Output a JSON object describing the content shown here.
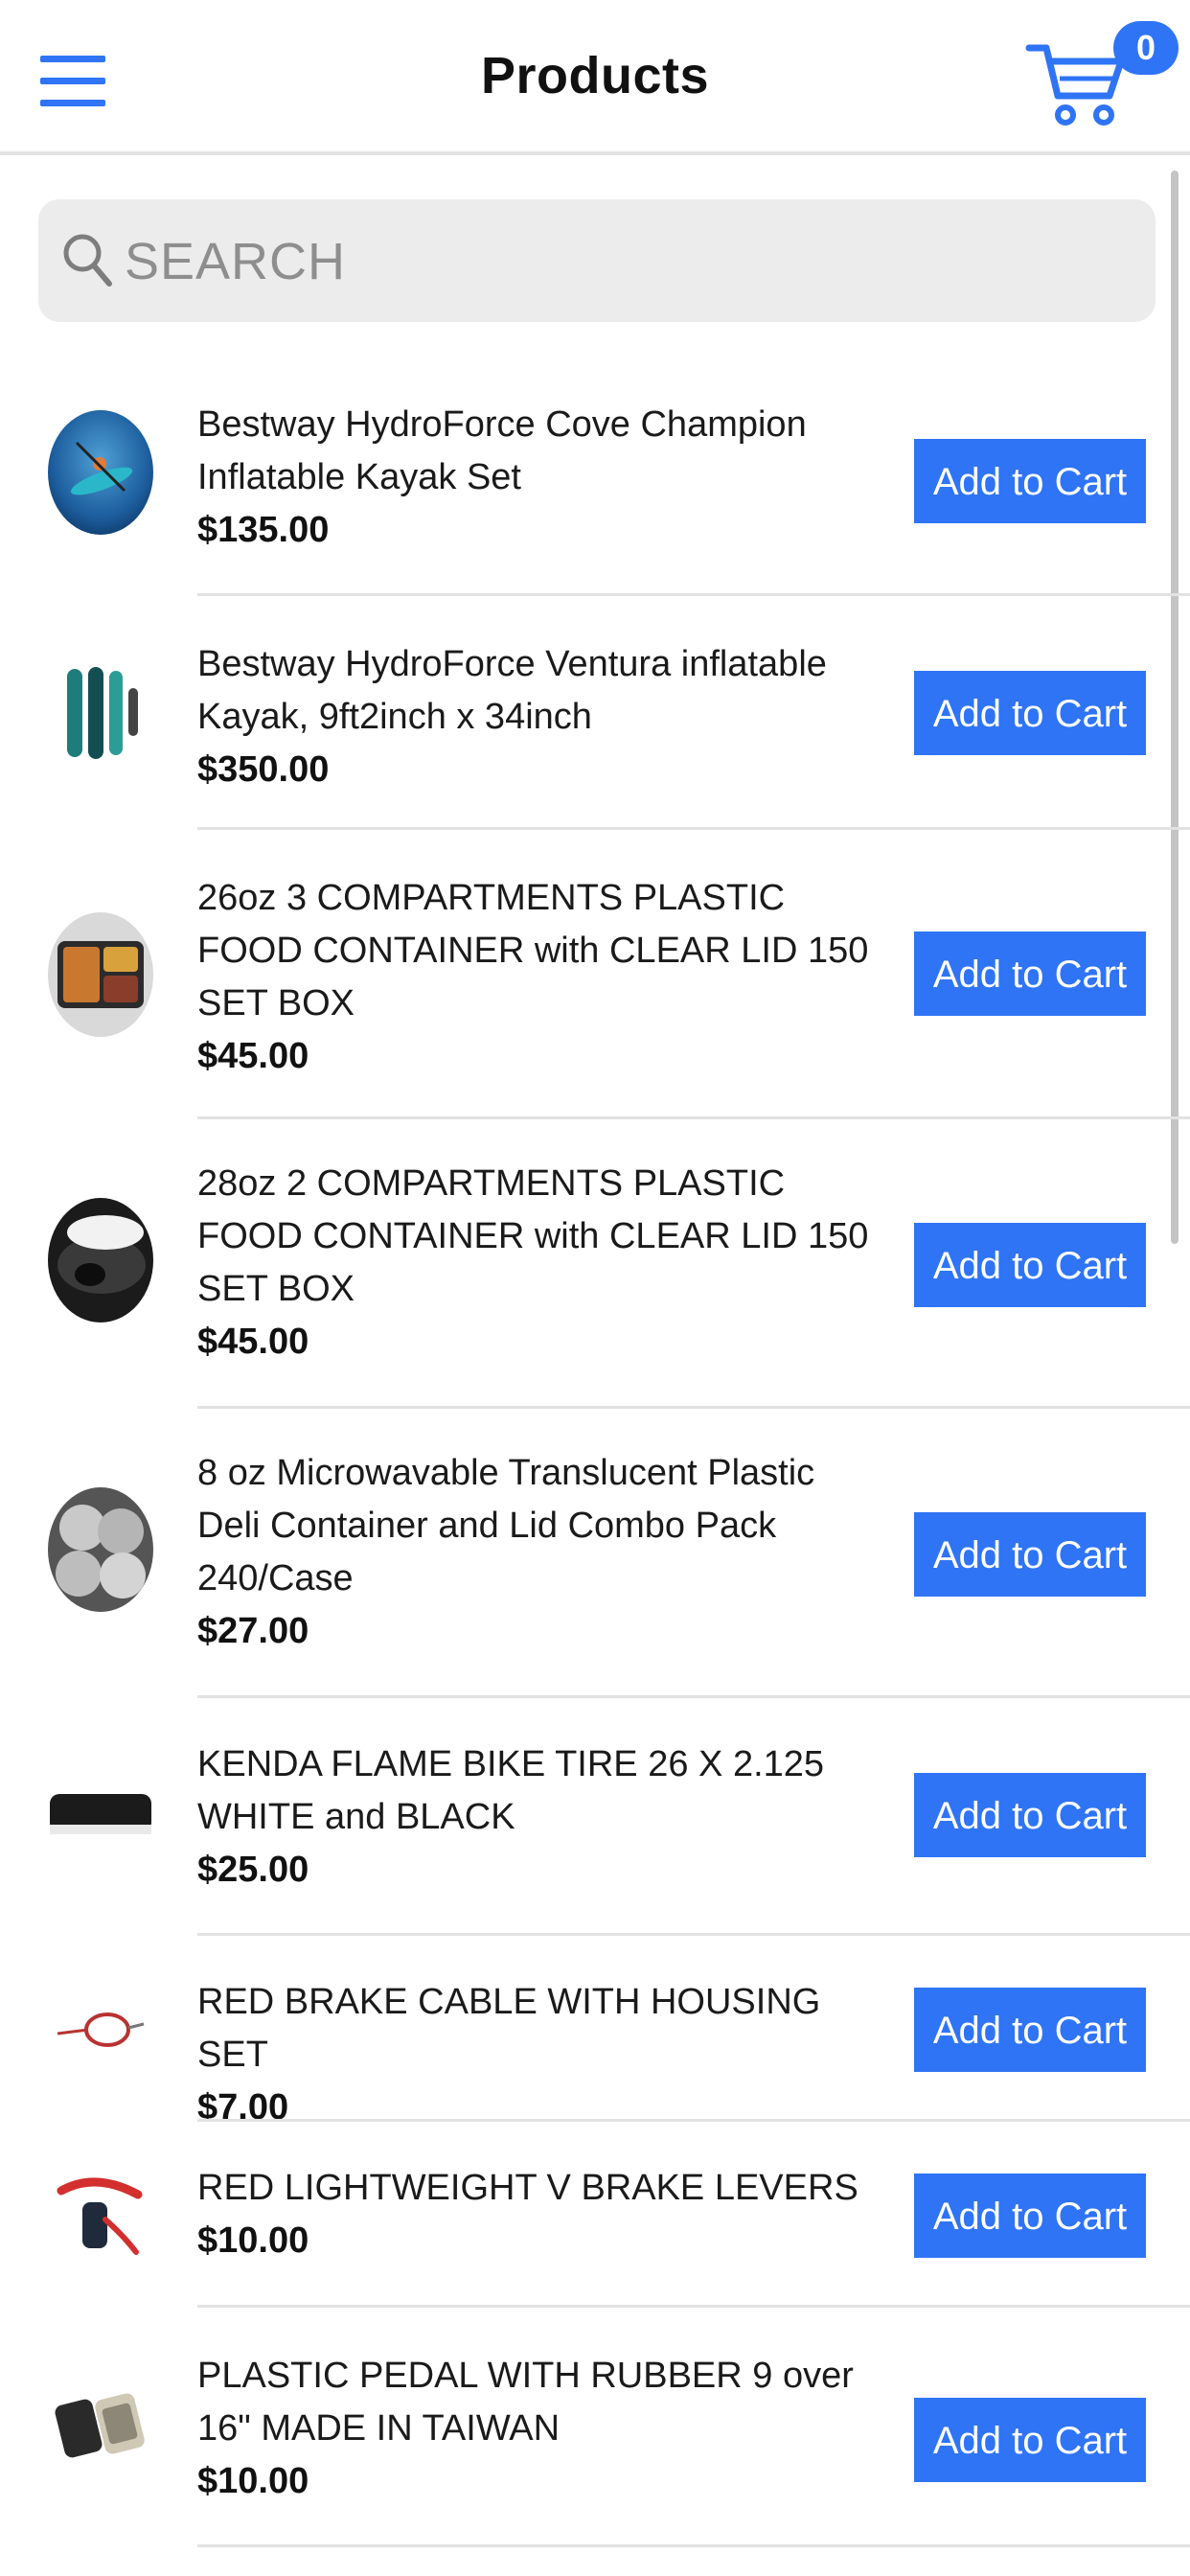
{
  "header": {
    "title": "Products",
    "cart_count": "0"
  },
  "search": {
    "placeholder": "SEARCH"
  },
  "products": [
    {
      "name": "Bestway HydroForce Cove Champion Inflatable Kayak Set",
      "price": "$135.00",
      "button": "Add to Cart"
    },
    {
      "name": "Bestway HydroForce Ventura inflatable Kayak, 9ft2inch x 34inch",
      "price": "$350.00",
      "button": "Add to Cart"
    },
    {
      "name": "26oz 3 COMPARTMENTS PLASTIC FOOD CONTAINER with CLEAR LID 150 SET BOX",
      "price": "$45.00",
      "button": "Add to Cart"
    },
    {
      "name": "28oz 2 COMPARTMENTS PLASTIC FOOD CONTAINER with CLEAR LID 150 SET BOX",
      "price": "$45.00",
      "button": "Add to Cart"
    },
    {
      "name": "8 oz Microwavable Translucent Plastic Deli Container and Lid Combo Pack 240/Case",
      "price": "$27.00",
      "button": "Add to Cart"
    },
    {
      "name": "KENDA FLAME BIKE TIRE 26 X 2.125 WHITE and BLACK",
      "price": "$25.00",
      "button": "Add to Cart"
    },
    {
      "name": "RED BRAKE CABLE WITH HOUSING SET",
      "price": "$7.00",
      "button": "Add to Cart"
    },
    {
      "name": "RED LIGHTWEIGHT V BRAKE LEVERS",
      "price": "$10.00",
      "button": "Add to Cart"
    },
    {
      "name": "PLASTIC PEDAL WITH RUBBER 9 over 16\" MADE IN TAIWAN",
      "price": "$10.00",
      "button": "Add to Cart"
    }
  ],
  "colors": {
    "accent": "#2f74f5",
    "divider": "#e2e2e2",
    "search_bg": "#ececec"
  }
}
